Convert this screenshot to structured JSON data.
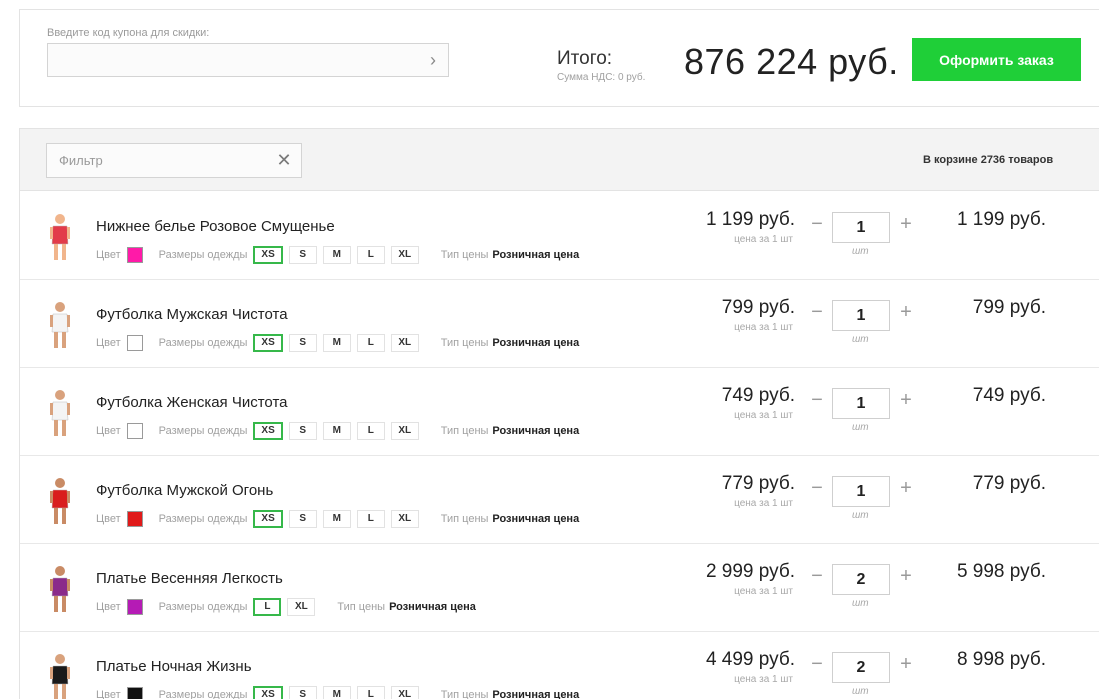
{
  "coupon": {
    "label": "Введите код купона для скидки:",
    "value": "",
    "go_icon": "chevron-right-icon"
  },
  "totals": {
    "label": "Итого:",
    "vat": "Сумма НДС: 0 руб.",
    "amount": "876 224 руб.",
    "checkout_label": "Оформить заказ",
    "checkout_color": "#1fcf38"
  },
  "cart": {
    "filter_placeholder": "Фильтр",
    "clear_icon": "close-icon",
    "count_text": "В корзине 2736 товаров",
    "labels": {
      "color": "Цвет",
      "sizes": "Размеры одежды",
      "price_type": "Тип цены",
      "price_type_value": "Розничная цена",
      "unit_note": "цена за 1 шт",
      "qty_unit": "шт",
      "minus": "−",
      "plus": "+"
    },
    "items": [
      {
        "name": "Нижнее белье Розовое Смущенье",
        "color": "#ff1aa8",
        "sizes": [
          "XS",
          "S",
          "M",
          "L",
          "XL"
        ],
        "selected_size": "XS",
        "unit_price": "1 199 руб.",
        "qty": "1",
        "total": "1 199 руб.",
        "thumb_color": "#e23b4a",
        "thumb_skin": "#f1b58c"
      },
      {
        "name": "Футболка Мужская Чистота",
        "color": "#ffffff",
        "sizes": [
          "XS",
          "S",
          "M",
          "L",
          "XL"
        ],
        "selected_size": "XS",
        "unit_price": "799 руб.",
        "qty": "1",
        "total": "799 руб.",
        "thumb_color": "#f4f4f4",
        "thumb_skin": "#d9a27d"
      },
      {
        "name": "Футболка Женская Чистота",
        "color": "#ffffff",
        "sizes": [
          "XS",
          "S",
          "M",
          "L",
          "XL"
        ],
        "selected_size": "XS",
        "unit_price": "749 руб.",
        "qty": "1",
        "total": "749 руб.",
        "thumb_color": "#f4f4f4",
        "thumb_skin": "#d9a27d"
      },
      {
        "name": "Футболка Мужской Огонь",
        "color": "#e01a1a",
        "sizes": [
          "XS",
          "S",
          "M",
          "L",
          "XL"
        ],
        "selected_size": "XS",
        "unit_price": "779 руб.",
        "qty": "1",
        "total": "779 руб.",
        "thumb_color": "#d91c1c",
        "thumb_skin": "#c98b65"
      },
      {
        "name": "Платье Весенняя Легкость",
        "color": "#b51bb5",
        "sizes": [
          "L",
          "XL"
        ],
        "selected_size": "L",
        "unit_price": "2 999 руб.",
        "qty": "2",
        "total": "5 998 руб.",
        "thumb_color": "#8a2a8a",
        "thumb_skin": "#c98b65"
      },
      {
        "name": "Платье Ночная Жизнь",
        "color": "#111111",
        "sizes": [
          "XS",
          "S",
          "M",
          "L",
          "XL"
        ],
        "selected_size": "XS",
        "unit_price": "4 499 руб.",
        "qty": "2",
        "total": "8 998 руб.",
        "thumb_color": "#1a1a1a",
        "thumb_skin": "#d9a27d"
      }
    ]
  }
}
